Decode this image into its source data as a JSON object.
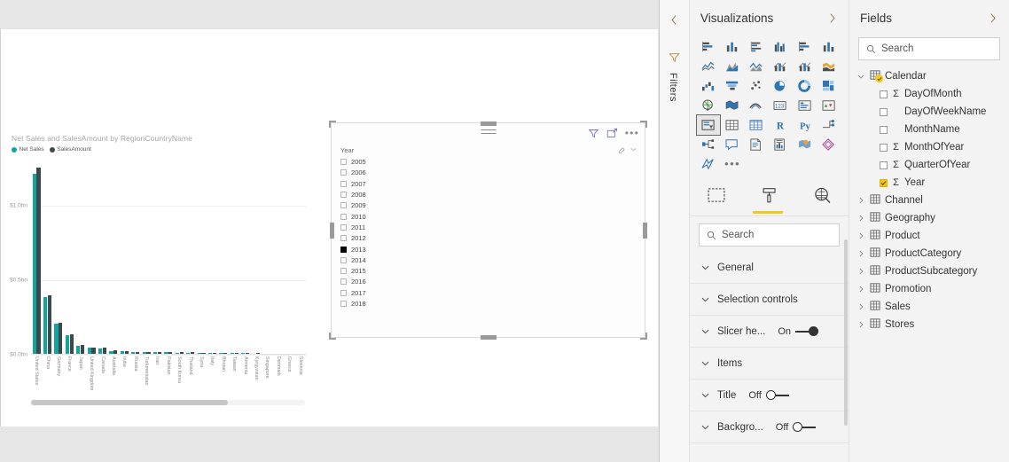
{
  "canvas": {
    "chart": {
      "title": "Net Sales and SalesAmount by RegionCountryName",
      "scroll_percent": 72
    },
    "slicer": {
      "field_label": "Year",
      "items": [
        {
          "label": "2005",
          "checked": false
        },
        {
          "label": "2006",
          "checked": false
        },
        {
          "label": "2007",
          "checked": false
        },
        {
          "label": "2008",
          "checked": false
        },
        {
          "label": "2009",
          "checked": false
        },
        {
          "label": "2010",
          "checked": false
        },
        {
          "label": "2011",
          "checked": false
        },
        {
          "label": "2012",
          "checked": false
        },
        {
          "label": "2013",
          "checked": true
        },
        {
          "label": "2014",
          "checked": false
        },
        {
          "label": "2015",
          "checked": false
        },
        {
          "label": "2016",
          "checked": false
        },
        {
          "label": "2017",
          "checked": false
        },
        {
          "label": "2018",
          "checked": false
        }
      ],
      "header_icons": [
        "filter-icon",
        "focus-mode-icon",
        "more-options-icon"
      ],
      "tool_icons": [
        "clear-selection-icon",
        "chevron-down-icon"
      ]
    }
  },
  "filters_rail": {
    "label": "Filters",
    "icons": [
      "chevron-left-icon",
      "filter-funnel-icon"
    ]
  },
  "visualizations": {
    "title": "Visualizations",
    "expand_icon": "chevron-right-icon",
    "icons": [
      "stacked-bar-chart-icon",
      "stacked-column-chart-icon",
      "clustered-bar-chart-icon",
      "clustered-column-chart-icon",
      "100-stacked-bar-chart-icon",
      "100-stacked-column-chart-icon",
      "line-chart-icon",
      "area-chart-icon",
      "stacked-area-chart-icon",
      "line-stacked-column-chart-icon",
      "line-clustered-column-chart-icon",
      "ribbon-chart-icon",
      "waterfall-chart-icon",
      "funnel-chart-icon",
      "scatter-chart-icon",
      "pie-chart-icon",
      "donut-chart-icon",
      "treemap-icon",
      "map-icon",
      "filled-map-icon",
      "arcgis-map-icon",
      "card-icon",
      "multi-row-card-icon",
      "kpi-icon",
      "slicer-icon",
      "table-icon",
      "matrix-icon",
      "r-script-visual-icon",
      "python-visual-icon",
      "key-influencers-icon",
      "decomposition-tree-icon",
      "q-and-a-icon",
      "paginated-report-icon",
      "smart-narrative-icon",
      "azure-map-icon",
      "power-apps-icon",
      "power-automate-icon"
    ],
    "selected_icon_index": 24,
    "more_icon": "ellipsis-icon",
    "tool_tabs": [
      {
        "name": "fields-tab",
        "icon": "fields-pane-icon",
        "active": false
      },
      {
        "name": "format-tab",
        "icon": "paint-roller-icon",
        "active": true
      },
      {
        "name": "analytics-tab",
        "icon": "magnifier-analytics-icon",
        "active": false
      }
    ],
    "search_placeholder": "Search",
    "format_sections": [
      {
        "label": "General",
        "toggle": null
      },
      {
        "label": "Selection controls",
        "toggle": null
      },
      {
        "label": "Slicer he...",
        "toggle": "On"
      },
      {
        "label": "Items",
        "toggle": null
      },
      {
        "label": "Title",
        "toggle": "Off"
      },
      {
        "label": "Backgro...",
        "toggle": "Off"
      }
    ]
  },
  "fields": {
    "title": "Fields",
    "expand_icon": "chevron-right-icon",
    "search_placeholder": "Search",
    "tables": [
      {
        "name": "Calendar",
        "expanded": true,
        "has_badge": true,
        "columns": [
          {
            "name": "DayOfMonth",
            "checked": false,
            "aggregate": true
          },
          {
            "name": "DayOfWeekName",
            "checked": false,
            "aggregate": false
          },
          {
            "name": "MonthName",
            "checked": false,
            "aggregate": false
          },
          {
            "name": "MonthOfYear",
            "checked": false,
            "aggregate": true
          },
          {
            "name": "QuarterOfYear",
            "checked": false,
            "aggregate": true
          },
          {
            "name": "Year",
            "checked": true,
            "aggregate": true
          }
        ]
      },
      {
        "name": "Channel",
        "expanded": false,
        "columns": []
      },
      {
        "name": "Geography",
        "expanded": false,
        "columns": []
      },
      {
        "name": "Product",
        "expanded": false,
        "columns": []
      },
      {
        "name": "ProductCategory",
        "expanded": false,
        "columns": []
      },
      {
        "name": "ProductSubcategory",
        "expanded": false,
        "columns": []
      },
      {
        "name": "Promotion",
        "expanded": false,
        "columns": []
      },
      {
        "name": "Sales",
        "expanded": false,
        "columns": []
      },
      {
        "name": "Stores",
        "expanded": false,
        "columns": []
      }
    ]
  },
  "colors": {
    "net_sales": "#12A5A0",
    "sales_amount": "#3A4A4C",
    "accent_yellow": "#F2C811",
    "pane_bg": "#F3F3F3",
    "canvas_bg": "#E6E6E6"
  },
  "chart_data": {
    "type": "bar",
    "title": "Net Sales and SalesAmount by RegionCountryName",
    "xlabel": "",
    "ylabel": "",
    "ylim": [
      0,
      1.3
    ],
    "ytick_labels": [
      "$0.0bn",
      "$0.5bn",
      "$1.0bn"
    ],
    "ytick_values": [
      0,
      0.5,
      1.0
    ],
    "grid": true,
    "legend_position": "top-left",
    "categories": [
      "United States",
      "China",
      "Germany",
      "France",
      "Japan",
      "United Kingdom",
      "Canada",
      "Australia",
      "India",
      "Russia",
      "Turkmenistan",
      "Iran",
      "Pakistan",
      "South Korea",
      "Thailand",
      "Syria",
      "Italy",
      "Bhutan",
      "Taiwan",
      "Armenia",
      "Kyrgyzstan",
      "Singapore",
      "Denmark",
      "Greece",
      "Slovenia"
    ],
    "series": [
      {
        "name": "Net Sales",
        "color": "#12A5A0",
        "values": [
          1.21,
          0.385,
          0.205,
          0.132,
          0.061,
          0.048,
          0.044,
          0.026,
          0.023,
          0.017,
          0.016,
          0.015,
          0.015,
          0.014,
          0.014,
          0.013,
          0.012,
          0.011,
          0.01,
          0.009,
          0.008,
          0.008,
          0.007,
          0.006,
          0.005
        ]
      },
      {
        "name": "SalesAmount",
        "color": "#3A4A4C",
        "values": [
          1.255,
          0.398,
          0.215,
          0.138,
          0.064,
          0.05,
          0.046,
          0.027,
          0.024,
          0.018,
          0.017,
          0.016,
          0.016,
          0.015,
          0.015,
          0.014,
          0.013,
          0.012,
          0.011,
          0.01,
          0.009,
          0.008,
          0.007,
          0.007,
          0.006
        ]
      }
    ]
  }
}
